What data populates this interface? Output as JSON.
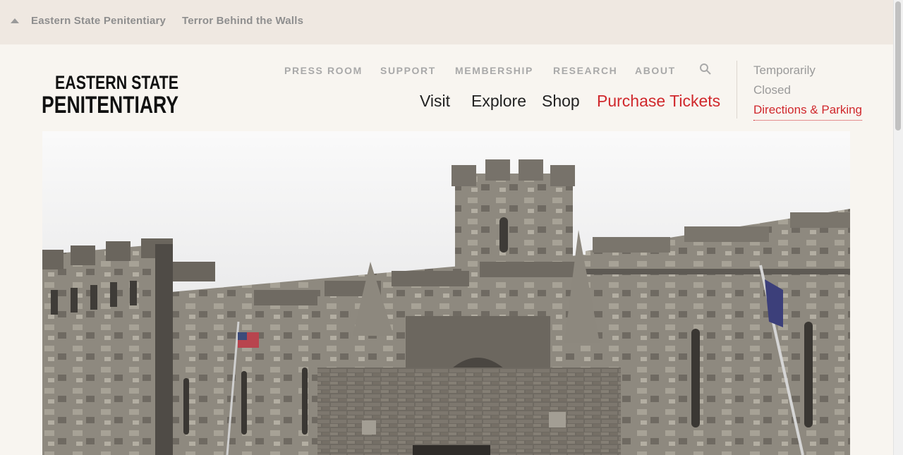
{
  "topbar": {
    "links": [
      "Eastern State Penitentiary",
      "Terror Behind the Walls"
    ]
  },
  "logo": {
    "line1": "EASTERN STATE",
    "line2": "PENITENTIARY"
  },
  "utility_nav": [
    "PRESS ROOM",
    "SUPPORT",
    "MEMBERSHIP",
    "RESEARCH",
    "ABOUT"
  ],
  "main_nav": {
    "visit": "Visit",
    "explore": "Explore",
    "shop": "Shop",
    "tickets": "Purchase Tickets"
  },
  "status": {
    "line1": "Temporarily",
    "line2": "Closed",
    "directions": "Directions & Parking"
  },
  "colors": {
    "accent": "#d0282c",
    "topbar_bg": "#efe8e1",
    "page_bg": "#f8f5f0"
  },
  "icons": {
    "collapse": "caret-up-icon",
    "search": "search-icon"
  }
}
